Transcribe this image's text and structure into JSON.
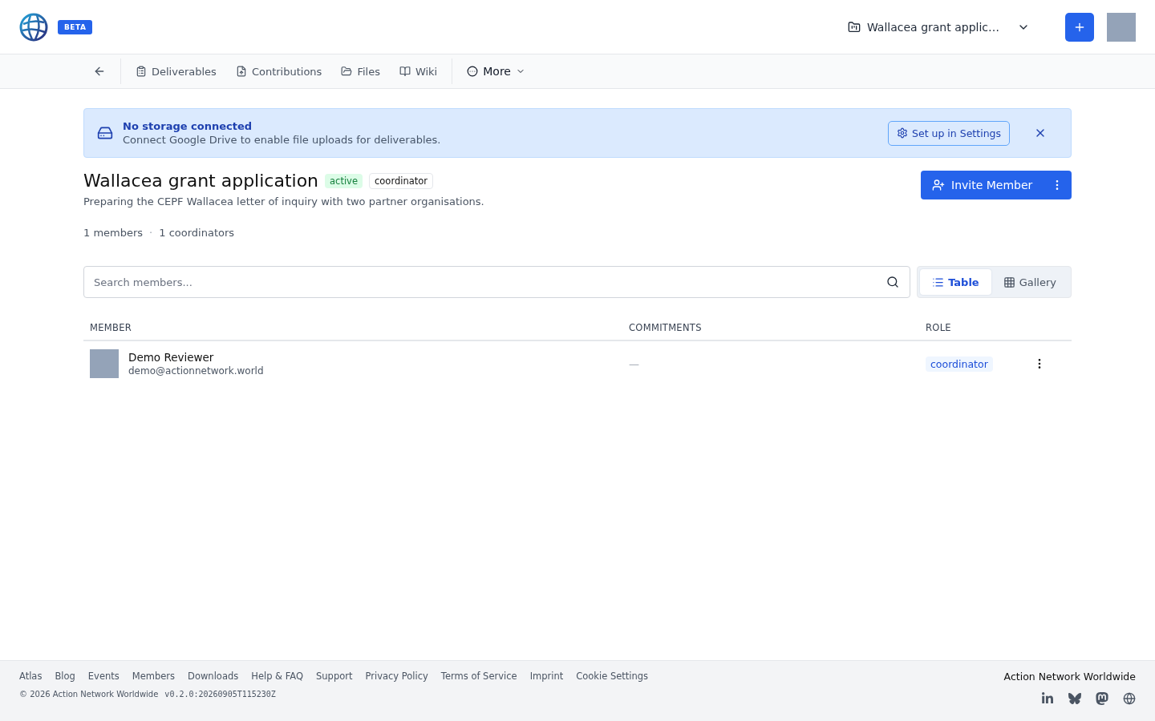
{
  "header": {
    "badge": "BETA",
    "project_switcher": "Wallacea grant applic…"
  },
  "nav": [
    {
      "kind": "back"
    },
    {
      "kind": "deliverables",
      "label": "Deliverables"
    },
    {
      "kind": "contributions",
      "label": "Contributions"
    },
    {
      "kind": "files",
      "label": "Files"
    },
    {
      "kind": "wiki",
      "label": "Wiki"
    },
    {
      "kind": "more",
      "label": "More"
    }
  ],
  "alert": {
    "title": "No storage connected",
    "text": "Connect Google Drive to enable file uploads for deliverables.",
    "button": "Set up in Settings"
  },
  "project": {
    "title": "Wallacea grant application",
    "badges": [
      {
        "kind": "status",
        "label": "active"
      },
      {
        "kind": "role",
        "label": "coordinator"
      }
    ],
    "description": "Preparing the CEPF Wallacea letter of inquiry with two partner organisations.",
    "stats": [
      "1 members",
      "1 coordinators"
    ],
    "stats_separator": "·",
    "invite_button": "Invite Member"
  },
  "search": {
    "placeholder": "Search members..."
  },
  "view_tabs": [
    {
      "kind": "table",
      "label": "Table",
      "selected": true
    },
    {
      "kind": "gallery",
      "label": "Gallery",
      "selected": false
    }
  ],
  "table": {
    "columns": [
      "MEMBER",
      "COMMITMENTS",
      "ROLE"
    ],
    "rows": [
      {
        "name": "Demo Reviewer",
        "email": "demo@actionnetwork.world",
        "commitments": "—",
        "role": "coordinator"
      }
    ]
  },
  "footer": {
    "links": [
      "Atlas",
      "Blog",
      "Events",
      "Members",
      "Downloads",
      "Help & FAQ",
      "Support",
      "Privacy Policy",
      "Terms of Service",
      "Imprint",
      "Cookie Settings"
    ],
    "copyright": "© 2026 Action Network Worldwide",
    "version": "v0.2.0:20260905T115230Z",
    "org": "Action Network Worldwide",
    "socials": [
      {
        "kind": "linkedin"
      },
      {
        "kind": "bluesky"
      },
      {
        "kind": "mastodon"
      },
      {
        "kind": "web"
      }
    ]
  }
}
